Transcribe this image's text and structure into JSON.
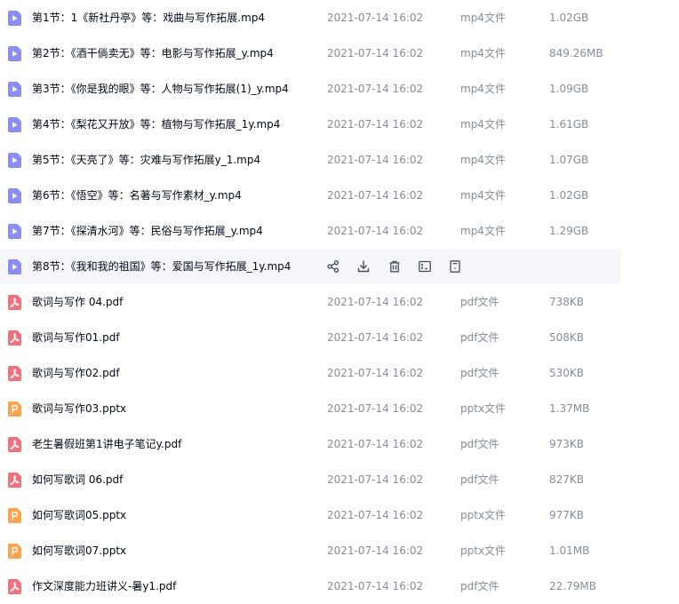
{
  "colors": {
    "video_icon": "#8c8cf6",
    "pdf_icon": "#f2707c",
    "pptx_icon": "#ffa24b",
    "row_hover": "#f5f6f9",
    "name_text": "#03081a",
    "meta_text": "#878c9c",
    "action_icon": "#454d5a"
  },
  "files": [
    {
      "name": "第1节：1《新社丹亭》等：戏曲与写作拓展.mp4",
      "date": "2021-07-14 16:02",
      "type": "mp4文件",
      "size": "1.02GB",
      "icon": "video-file-icon"
    },
    {
      "name": "第2节：《酒干倘卖无》等：电影与写作拓展_y.mp4",
      "date": "2021-07-14 16:02",
      "type": "mp4文件",
      "size": "849.26MB",
      "icon": "video-file-icon"
    },
    {
      "name": "第3节：《你是我的眼》等：人物与写作拓展(1)_y.mp4",
      "date": "2021-07-14 16:02",
      "type": "mp4文件",
      "size": "1.09GB",
      "icon": "video-file-icon"
    },
    {
      "name": "第4节：《梨花又开放》等：植物与写作拓展_1y.mp4",
      "date": "2021-07-14 16:02",
      "type": "mp4文件",
      "size": "1.61GB",
      "icon": "video-file-icon"
    },
    {
      "name": "第5节：《天亮了》等：灾难与写作拓展y_1.mp4",
      "date": "2021-07-14 16:02",
      "type": "mp4文件",
      "size": "1.07GB",
      "icon": "video-file-icon"
    },
    {
      "name": "第6节：《悟空》等：名著与写作素材_y.mp4",
      "date": "2021-07-14 16:02",
      "type": "mp4文件",
      "size": "1.02GB",
      "icon": "video-file-icon"
    },
    {
      "name": "第7节：《探清水河》等：民俗与写作拓展_y.mp4",
      "date": "2021-07-14 16:02",
      "type": "mp4文件",
      "size": "1.29GB",
      "icon": "video-file-icon"
    },
    {
      "name": "第8节：《我和我的祖国》等：爱国与写作拓展_1y.mp4",
      "date": "",
      "type": "",
      "size": "",
      "icon": "video-file-icon",
      "hovered": true,
      "actions": [
        {
          "name": "share-icon"
        },
        {
          "name": "download-icon"
        },
        {
          "name": "delete-icon"
        },
        {
          "name": "rename-icon"
        },
        {
          "name": "more-icon"
        }
      ]
    },
    {
      "name": "歌词与写作 04.pdf",
      "date": "2021-07-14 16:02",
      "type": "pdf文件",
      "size": "738KB",
      "icon": "pdf-file-icon"
    },
    {
      "name": "歌词与写作01.pdf",
      "date": "2021-07-14 16:02",
      "type": "pdf文件",
      "size": "508KB",
      "icon": "pdf-file-icon"
    },
    {
      "name": "歌词与写作02.pdf",
      "date": "2021-07-14 16:02",
      "type": "pdf文件",
      "size": "530KB",
      "icon": "pdf-file-icon"
    },
    {
      "name": "歌词与写作03.pptx",
      "date": "2021-07-14 16:02",
      "type": "pptx文件",
      "size": "1.37MB",
      "icon": "pptx-file-icon"
    },
    {
      "name": "老生暑假班第1讲电子笔记y.pdf",
      "date": "2021-07-14 16:02",
      "type": "pdf文件",
      "size": "973KB",
      "icon": "pdf-file-icon"
    },
    {
      "name": "如何写歌词 06.pdf",
      "date": "2021-07-14 16:02",
      "type": "pdf文件",
      "size": "827KB",
      "icon": "pdf-file-icon"
    },
    {
      "name": "如何写歌词05.pptx",
      "date": "2021-07-14 16:02",
      "type": "pptx文件",
      "size": "977KB",
      "icon": "pptx-file-icon"
    },
    {
      "name": "如何写歌词07.pptx",
      "date": "2021-07-14 16:02",
      "type": "pptx文件",
      "size": "1.01MB",
      "icon": "pptx-file-icon"
    },
    {
      "name": "作文深度能力班讲义-暑y1.pdf",
      "date": "2021-07-14 16:02",
      "type": "pdf文件",
      "size": "22.79MB",
      "icon": "pdf-file-icon"
    }
  ]
}
